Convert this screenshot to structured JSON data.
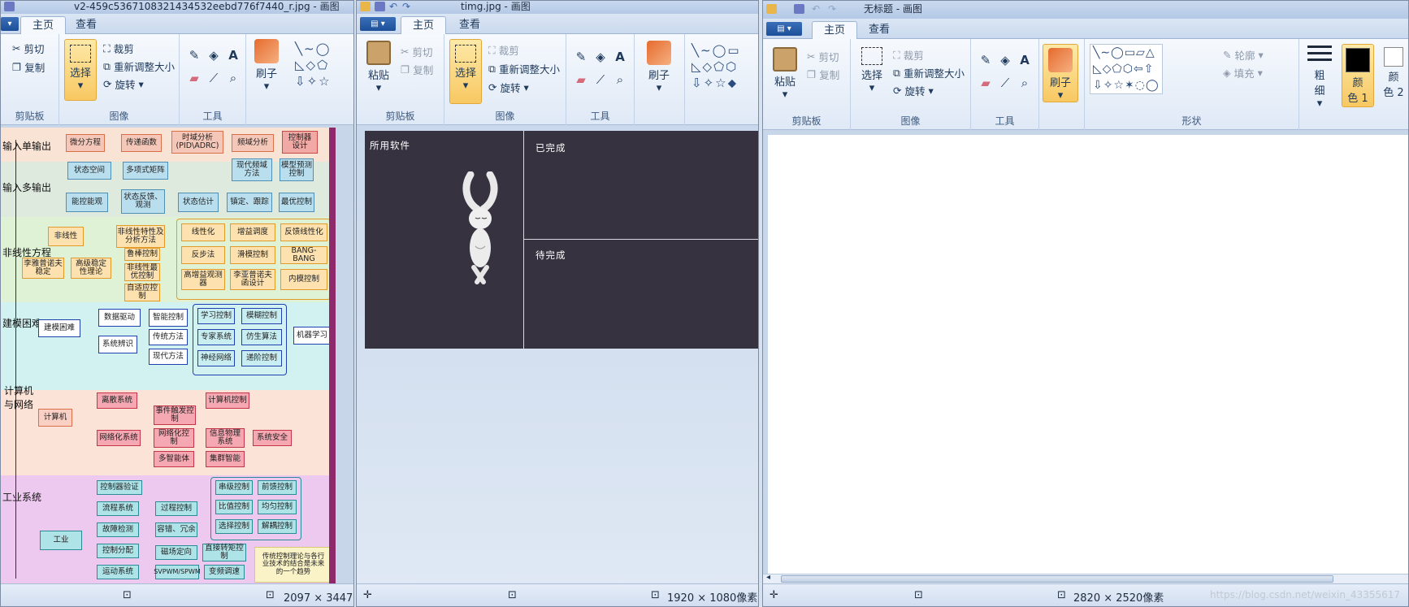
{
  "window1": {
    "title": "v2-459c5367108321434532eebd776f7440_r.jpg - 画图",
    "tabs": [
      "主页",
      "查看"
    ],
    "clipboard": {
      "cut": "剪切",
      "copy": "复制",
      "group": "剪贴板"
    },
    "image": {
      "select": "选择",
      "resize": "重新调整大小",
      "rotate": "旋转",
      "crop": "裁剪",
      "group": "图像"
    },
    "tools": {
      "group": "工具"
    },
    "brush": "刷子",
    "status": {
      "size": "2097 × 3447像"
    },
    "diagram": {
      "bands": [
        "输入单输出",
        "输入多输出",
        "非线性方程",
        "建模困难",
        "计算机与网络",
        "工业系统"
      ],
      "row1": [
        "微分方程",
        "传递函数",
        "时域分析\n(PID\\ADRC)",
        "频域分析",
        "控制器\n设计"
      ],
      "row2": [
        "状态空间",
        "多项式矩阵",
        "现代频域\n方法",
        "模型预测\n控制"
      ],
      "row3": [
        "能控能观",
        "状态反馈、\n观测",
        "状态估计",
        "镇定、跟踪",
        "最优控制"
      ],
      "nonlinear_left": [
        "非线性",
        "非线性特性及\n分析方法",
        "李雅普诺夫\n稳定",
        "高级稳定\n性理论",
        "鲁棒控制",
        "非线性最\n优控制",
        "自适应控\n制"
      ],
      "nonlinear_right": [
        "线性化",
        "增益调度",
        "反馈线性化",
        "反步法",
        "滑模控制",
        "BANG-BANG",
        "高增益观测\n器",
        "李亚普诺夫\n函设计",
        "内模控制"
      ],
      "modeling": [
        "建模困难",
        "数据驱动",
        "系统辨识",
        "智能控制",
        "传统方法",
        "现代方法",
        "学习控制",
        "模糊控制",
        "专家系统",
        "仿生算法",
        "神经网络",
        "递阶控制",
        "机器学习"
      ],
      "network": [
        "计算机",
        "离散系统",
        "计算机控制",
        "事件触发控\n制",
        "网络化系统",
        "网络化控\n制",
        "信息物理\n系统",
        "系统安全",
        "多智能体",
        "集群智能"
      ],
      "industry": [
        "工业",
        "控制器验证",
        "流程系统",
        "过程控制",
        "故障检测",
        "容错、冗余",
        "控制分配",
        "运动系统",
        "磁场定向",
        "直接转矩控\n制",
        "SVPWM/SPWM",
        "变频调速",
        "串级控制",
        "前馈控制",
        "比值控制",
        "均匀控制",
        "选择控制",
        "解耦控制"
      ],
      "note": "传统控制理论与各行\n业技术的结合是未来\n的一个趋势"
    }
  },
  "window2": {
    "title": "timg.jpg - 画图",
    "tabs": [
      "主页",
      "查看"
    ],
    "clipboard": {
      "paste": "粘贴",
      "cut": "剪切",
      "copy": "复制",
      "group": "剪贴板"
    },
    "image": {
      "select": "选择",
      "crop": "裁剪",
      "resize": "重新调整大小",
      "rotate": "旋转",
      "group": "图像"
    },
    "tools": {
      "group": "工具"
    },
    "brush": "刷子",
    "image_text": {
      "software": "所用软件",
      "done": "已完成",
      "todo": "待完成"
    },
    "status": {
      "size": "1920 × 1080像素"
    }
  },
  "window3": {
    "title": "无标题 - 画图",
    "tabs": [
      "主页",
      "查看"
    ],
    "clipboard": {
      "paste": "粘贴",
      "cut": "剪切",
      "copy": "复制",
      "group": "剪贴板"
    },
    "image": {
      "select": "选择",
      "crop": "裁剪",
      "resize": "重新调整大小",
      "rotate": "旋转",
      "group": "图像"
    },
    "tools": {
      "group": "工具"
    },
    "brush": "刷子",
    "shapes": {
      "outline": "轮廓",
      "fill": "填充",
      "group": "形状"
    },
    "size": "粗\n细",
    "color1": "颜\n色 1",
    "color2": "颜\n色 2",
    "status": {
      "size": "2820 × 2520像素"
    },
    "watermark": "https://blog.csdn.net/weixin_43355617"
  },
  "colors": {
    "accent_select": "#f8c862",
    "dark_image": "#36323f",
    "ribbon": "#e4ecf7"
  }
}
